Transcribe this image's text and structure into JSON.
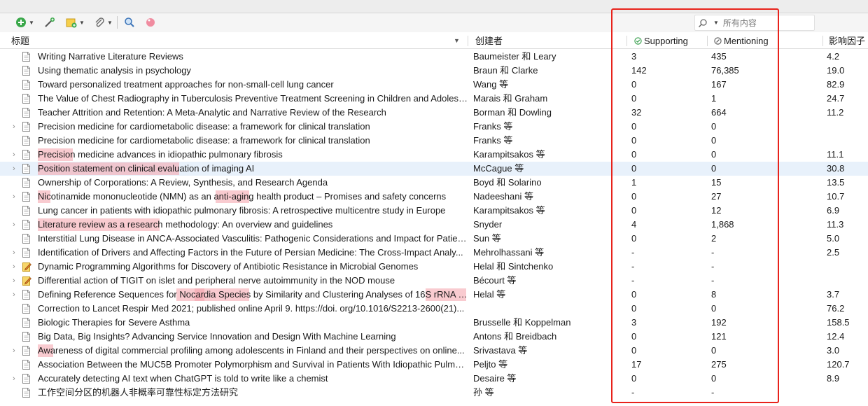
{
  "toolbar": {
    "new_item_icon": "green-plus-circle-icon",
    "add_by_identifier_icon": "wand-icon",
    "new_note_icon": "note-icon",
    "attachment_icon": "paperclip-icon",
    "locate_icon": "magnifier-icon",
    "tag_icon": "pink-tag-icon"
  },
  "search": {
    "placeholder": "所有内容",
    "icon": "search-icon"
  },
  "columns": {
    "title": "标题",
    "creator": "创建者",
    "supporting": "Supporting",
    "mentioning": "Mentioning",
    "impact": "影响因子"
  },
  "colors": {
    "highlight": "#f4a0aa",
    "selected_row": "#e8f1fb",
    "annotation_box": "#e8221b"
  },
  "rows": [
    {
      "title": "Writing Narrative Literature Reviews",
      "creator": "Baumeister 和 Leary",
      "supporting": "3",
      "mentioning": "435",
      "impact": "4.2",
      "expand": false,
      "icon": "document"
    },
    {
      "title": "Using thematic analysis in psychology",
      "creator": "Braun 和 Clarke",
      "supporting": "142",
      "mentioning": "76,385",
      "impact": "19.0",
      "expand": false,
      "icon": "document"
    },
    {
      "title": "Toward personalized treatment approaches for non-small-cell lung cancer",
      "creator": "Wang 等",
      "supporting": "0",
      "mentioning": "167",
      "impact": "82.9",
      "expand": false,
      "icon": "document"
    },
    {
      "title": "The Value of Chest Radiography in Tuberculosis Preventive Treatment Screening in Children and Adolesc...",
      "creator": "Marais 和 Graham",
      "supporting": "0",
      "mentioning": "1",
      "impact": "24.7",
      "expand": false,
      "icon": "document"
    },
    {
      "title": "Teacher Attrition and Retention: A Meta-Analytic and Narrative Review of the Research",
      "creator": "Borman 和 Dowling",
      "supporting": "32",
      "mentioning": "664",
      "impact": "11.2",
      "expand": false,
      "icon": "document"
    },
    {
      "title": "Precision medicine for cardiometabolic disease: a framework for clinical translation",
      "creator": "Franks 等",
      "supporting": "0",
      "mentioning": "0",
      "impact": "",
      "expand": true,
      "icon": "document"
    },
    {
      "title": "Precision medicine for cardiometabolic disease: a framework for clinical translation",
      "creator": "Franks 等",
      "supporting": "0",
      "mentioning": "0",
      "impact": "",
      "expand": false,
      "icon": "document"
    },
    {
      "title": "Precision medicine advances in idiopathic pulmonary fibrosis",
      "creator": "Karampitsakos 等",
      "supporting": "0",
      "mentioning": "0",
      "impact": "11.1",
      "expand": true,
      "icon": "document"
    },
    {
      "title": "Position statement on clinical evaluation of imaging AI",
      "creator": "McCague 等",
      "supporting": "0",
      "mentioning": "0",
      "impact": "30.8",
      "expand": true,
      "icon": "document",
      "selected": true
    },
    {
      "title": "Ownership of Corporations: A Review, Synthesis, and Research Agenda",
      "creator": "Boyd 和 Solarino",
      "supporting": "1",
      "mentioning": "15",
      "impact": "13.5",
      "expand": false,
      "icon": "document"
    },
    {
      "title": "Nicotinamide mononucleotide (NMN) as an anti-aging health product – Promises and safety concerns",
      "creator": "Nadeeshani 等",
      "supporting": "0",
      "mentioning": "27",
      "impact": "10.7",
      "expand": true,
      "icon": "document"
    },
    {
      "title": "Lung cancer in patients with idiopathic pulmonary fibrosis: A retrospective multicentre study in Europe",
      "creator": "Karampitsakos 等",
      "supporting": "0",
      "mentioning": "12",
      "impact": "6.9",
      "expand": false,
      "icon": "document"
    },
    {
      "title": "Literature review as a research methodology: An overview and guidelines",
      "creator": "Snyder",
      "supporting": "4",
      "mentioning": "1,868",
      "impact": "11.3",
      "expand": true,
      "icon": "document"
    },
    {
      "title": "Interstitial Lung Disease in ANCA-Associated Vasculitis: Pathogenic Considerations and Impact for Patien...",
      "creator": "Sun 等",
      "supporting": "0",
      "mentioning": "2",
      "impact": "5.0",
      "expand": false,
      "icon": "document"
    },
    {
      "title": "Identification of Drivers and Affecting Factors in the Future of Persian Medicine: The Cross-Impact Analy...",
      "creator": "Mehrolhassani 等",
      "supporting": "-",
      "mentioning": "-",
      "impact": "2.5",
      "expand": true,
      "icon": "document"
    },
    {
      "title": "Dynamic Programming Algorithms for Discovery of Antibiotic Resistance in Microbial Genomes",
      "creator": "Helal 和 Sintchenko",
      "supporting": "-",
      "mentioning": "-",
      "impact": "",
      "expand": true,
      "icon": "note"
    },
    {
      "title": "Differential action of TIGIT on islet and peripheral nerve autoimmunity in the NOD mouse",
      "creator": "Bécourt 等",
      "supporting": "-",
      "mentioning": "-",
      "impact": "",
      "expand": true,
      "icon": "note"
    },
    {
      "title": "Defining Reference Sequences for Nocardia Species by Similarity and Clustering Analyses of 16S rRNA G...",
      "creator": "Helal 等",
      "supporting": "0",
      "mentioning": "8",
      "impact": "3.7",
      "expand": true,
      "icon": "document"
    },
    {
      "title": "Correction to Lancet Respir Med 2021; published online April 9. https://doi. org/10.1016/S2213-2600(21)...",
      "creator": "",
      "supporting": "0",
      "mentioning": "0",
      "impact": "76.2",
      "expand": false,
      "icon": "document"
    },
    {
      "title": "Biologic Therapies for Severe Asthma",
      "creator": "Brusselle 和 Koppelman",
      "supporting": "3",
      "mentioning": "192",
      "impact": "158.5",
      "expand": false,
      "icon": "document"
    },
    {
      "title": "Big Data, Big Insights? Advancing Service Innovation and Design With Machine Learning",
      "creator": "Antons 和 Breidbach",
      "supporting": "0",
      "mentioning": "121",
      "impact": "12.4",
      "expand": false,
      "icon": "document"
    },
    {
      "title": "Awareness of digital commercial profiling among adolescents in Finland and their perspectives on online...",
      "creator": "Srivastava 等",
      "supporting": "0",
      "mentioning": "0",
      "impact": "3.0",
      "expand": true,
      "icon": "document"
    },
    {
      "title": "Association Between the MUC5B Promoter Polymorphism and Survival in Patients With Idiopathic Pulmo...",
      "creator": "Peljto 等",
      "supporting": "17",
      "mentioning": "275",
      "impact": "120.7",
      "expand": false,
      "icon": "document"
    },
    {
      "title": "Accurately detecting AI text when ChatGPT is told to write like a chemist",
      "creator": "Desaire 等",
      "supporting": "0",
      "mentioning": "0",
      "impact": "8.9",
      "expand": true,
      "icon": "document"
    },
    {
      "title": "工作空间分区的机器人非概率可靠性标定方法研究",
      "creator": "孙 等",
      "supporting": "-",
      "mentioning": "-",
      "impact": "",
      "expand": false,
      "icon": "document"
    }
  ]
}
